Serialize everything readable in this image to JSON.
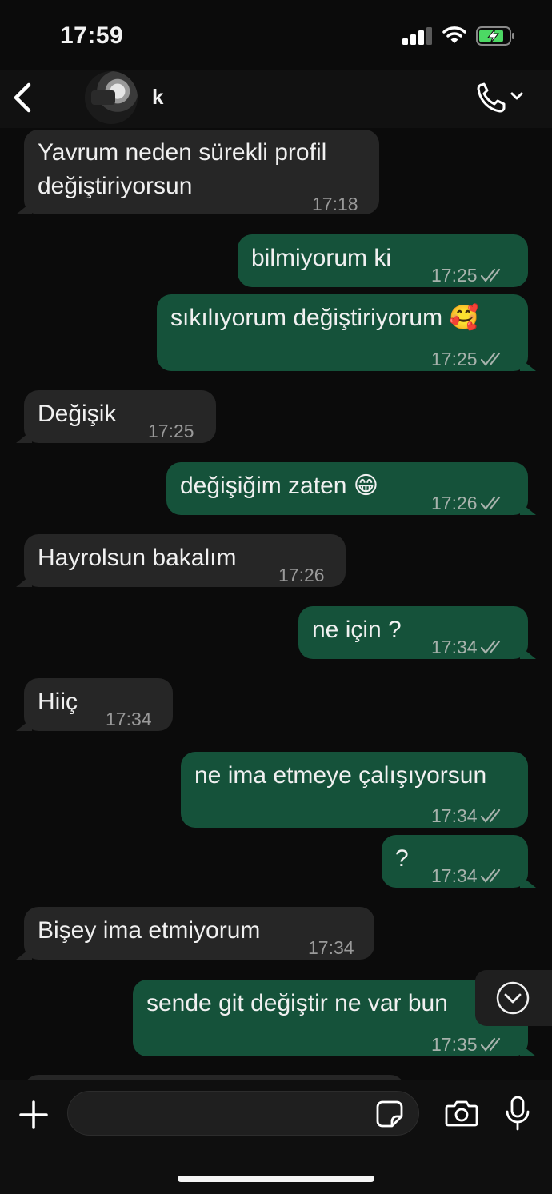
{
  "status_bar": {
    "time": "17:59"
  },
  "header": {
    "contact_name": "k"
  },
  "messages": [
    {
      "dir": "in",
      "lines": [
        "Yavrum neden sürekli profil",
        "değiştiriyorsun"
      ],
      "time": "17:18"
    },
    {
      "dir": "out",
      "lines": [
        "bilmiyorum ki"
      ],
      "time": "17:25"
    },
    {
      "dir": "out",
      "lines": [
        "sıkılıyorum değiştiriyorum 🥰"
      ],
      "time": "17:25"
    },
    {
      "dir": "in",
      "lines": [
        "Değişik"
      ],
      "time": "17:25"
    },
    {
      "dir": "out",
      "lines": [
        "değişiğim zaten 😁"
      ],
      "time": "17:26"
    },
    {
      "dir": "in",
      "lines": [
        "Hayrolsun bakalım"
      ],
      "time": "17:26"
    },
    {
      "dir": "out",
      "lines": [
        "ne için ?"
      ],
      "time": "17:34"
    },
    {
      "dir": "in",
      "lines": [
        "Hiiç"
      ],
      "time": "17:34"
    },
    {
      "dir": "out",
      "lines": [
        "ne ima etmeye çalışıyorsun"
      ],
      "time": "17:34"
    },
    {
      "dir": "out",
      "lines": [
        "?"
      ],
      "time": "17:34"
    },
    {
      "dir": "in",
      "lines": [
        "Bişey ima etmiyorum"
      ],
      "time": "17:34"
    },
    {
      "dir": "out",
      "lines": [
        "sende git değiştir ne var bun"
      ],
      "time": "17:35"
    }
  ],
  "icons": {
    "back": "chevron-left-icon",
    "call": "phone-icon",
    "scroll": "chevron-down-circle-icon",
    "attach": "plus-icon",
    "sticker": "sticker-icon",
    "camera": "camera-icon",
    "mic": "microphone-icon"
  },
  "colors": {
    "outgoing_bubble": "#15523a",
    "incoming_bubble": "#262626",
    "background": "#0b0b0b",
    "battery_charging": "#4cd964"
  }
}
